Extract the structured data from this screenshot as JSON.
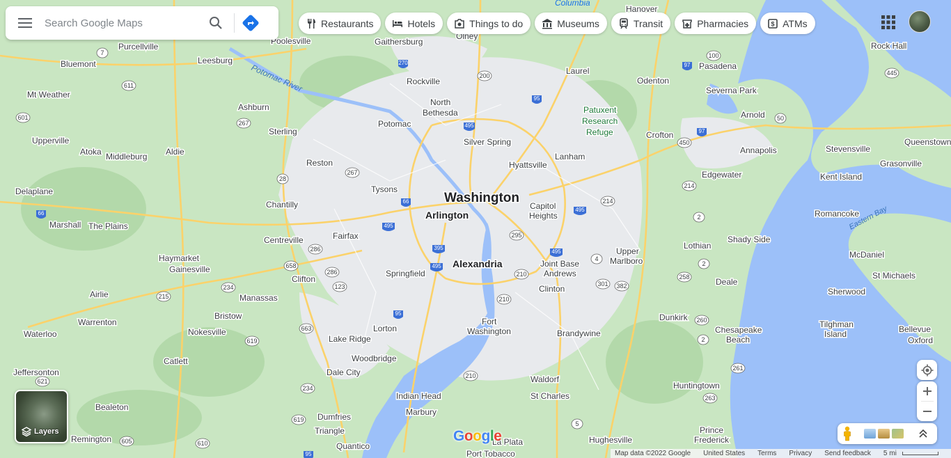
{
  "search": {
    "placeholder": "Search Google Maps"
  },
  "chips": [
    {
      "label": "Restaurants",
      "icon": "utensils-icon"
    },
    {
      "label": "Hotels",
      "icon": "bed-icon"
    },
    {
      "label": "Things to do",
      "icon": "camera-icon"
    },
    {
      "label": "Museums",
      "icon": "museum-icon"
    },
    {
      "label": "Transit",
      "icon": "train-icon"
    },
    {
      "label": "Pharmacies",
      "icon": "pharmacy-icon"
    },
    {
      "label": "ATMs",
      "icon": "atm-icon"
    }
  ],
  "layers": {
    "label": "Layers"
  },
  "logo": {
    "text": "Google"
  },
  "footer": {
    "map_data": "Map data ©2022 Google",
    "country": "United States",
    "terms": "Terms",
    "privacy": "Privacy",
    "feedback": "Send feedback",
    "scale": "5 mi"
  },
  "colors": {
    "water": "#9cc0f9",
    "land": "#c9e6c2",
    "urban": "#e8eaed",
    "road": "#fbd26a",
    "accent": "#1a73e8"
  },
  "map_labels": {
    "places_major": [
      "Washington",
      "Arlington",
      "Alexandria"
    ],
    "places": [
      "Purcellville",
      "Bluemont",
      "Mt Weather",
      "Upperville",
      "Atoka",
      "Middleburg",
      "Aldie",
      "Delaplane",
      "Marshall",
      "The Plains",
      "Haymarket",
      "Gainesville",
      "Warrenton",
      "Airlie",
      "Nokesville",
      "Waterloo",
      "Jeffersonton",
      "Catlett",
      "Bealeton",
      "Remington",
      "Leesburg",
      "Poolesville",
      "Ashburn",
      "Sterling",
      "Reston",
      "Chantilly",
      "Centreville",
      "Manassas",
      "Bristow",
      "Clifton",
      "Fairfax",
      "Tysons",
      "Springfield",
      "Lorton",
      "Lake Ridge",
      "Woodbridge",
      "Dale City",
      "Dumfries",
      "Triangle",
      "Quantico",
      "Indian Head",
      "Marbury",
      "La Plata",
      "Port Tobacco",
      "Gaithersburg",
      "Olney",
      "Rockville",
      "North Bethesda",
      "Potomac",
      "Silver Spring",
      "Laurel",
      "Hyattsville",
      "Lanham",
      "Capitol Heights",
      "Joint Base Andrews",
      "Clinton",
      "Fort Washington",
      "Brandywine",
      "Waldorf",
      "St Charles",
      "Hughesville",
      "Upper Marlboro",
      "Odenton",
      "Crofton",
      "Hanover",
      "Pasadena",
      "Severna Park",
      "Arnold",
      "Annapolis",
      "Edgewater",
      "Lothian",
      "Shady Side",
      "Deale",
      "Dunkirk",
      "Chesapeake Beach",
      "Huntingtown",
      "Prince Frederick",
      "Rock Hall",
      "Stevensville",
      "Queenstown",
      "Grasonville",
      "Kent Island",
      "Romancoke",
      "McDaniel",
      "St Michaels",
      "Sherwood",
      "Tilghman Island",
      "Bellevue",
      "Oxford",
      "Columbia"
    ],
    "water": [
      "Potomac River",
      "Eastern Bay"
    ],
    "parks": [
      "Patuxent Research Refuge"
    ],
    "routes": [
      "7",
      "611",
      "601",
      "17",
      "66",
      "15",
      "29",
      "215",
      "605",
      "621",
      "28",
      "267",
      "50",
      "286",
      "658",
      "234",
      "663",
      "123",
      "495",
      "95",
      "1",
      "395",
      "210",
      "270",
      "200",
      "29",
      "32",
      "97",
      "100",
      "450",
      "214",
      "301",
      "4",
      "382",
      "258",
      "260",
      "2",
      "261",
      "263",
      "5",
      "50",
      "445",
      "97",
      "610",
      "619"
    ]
  }
}
